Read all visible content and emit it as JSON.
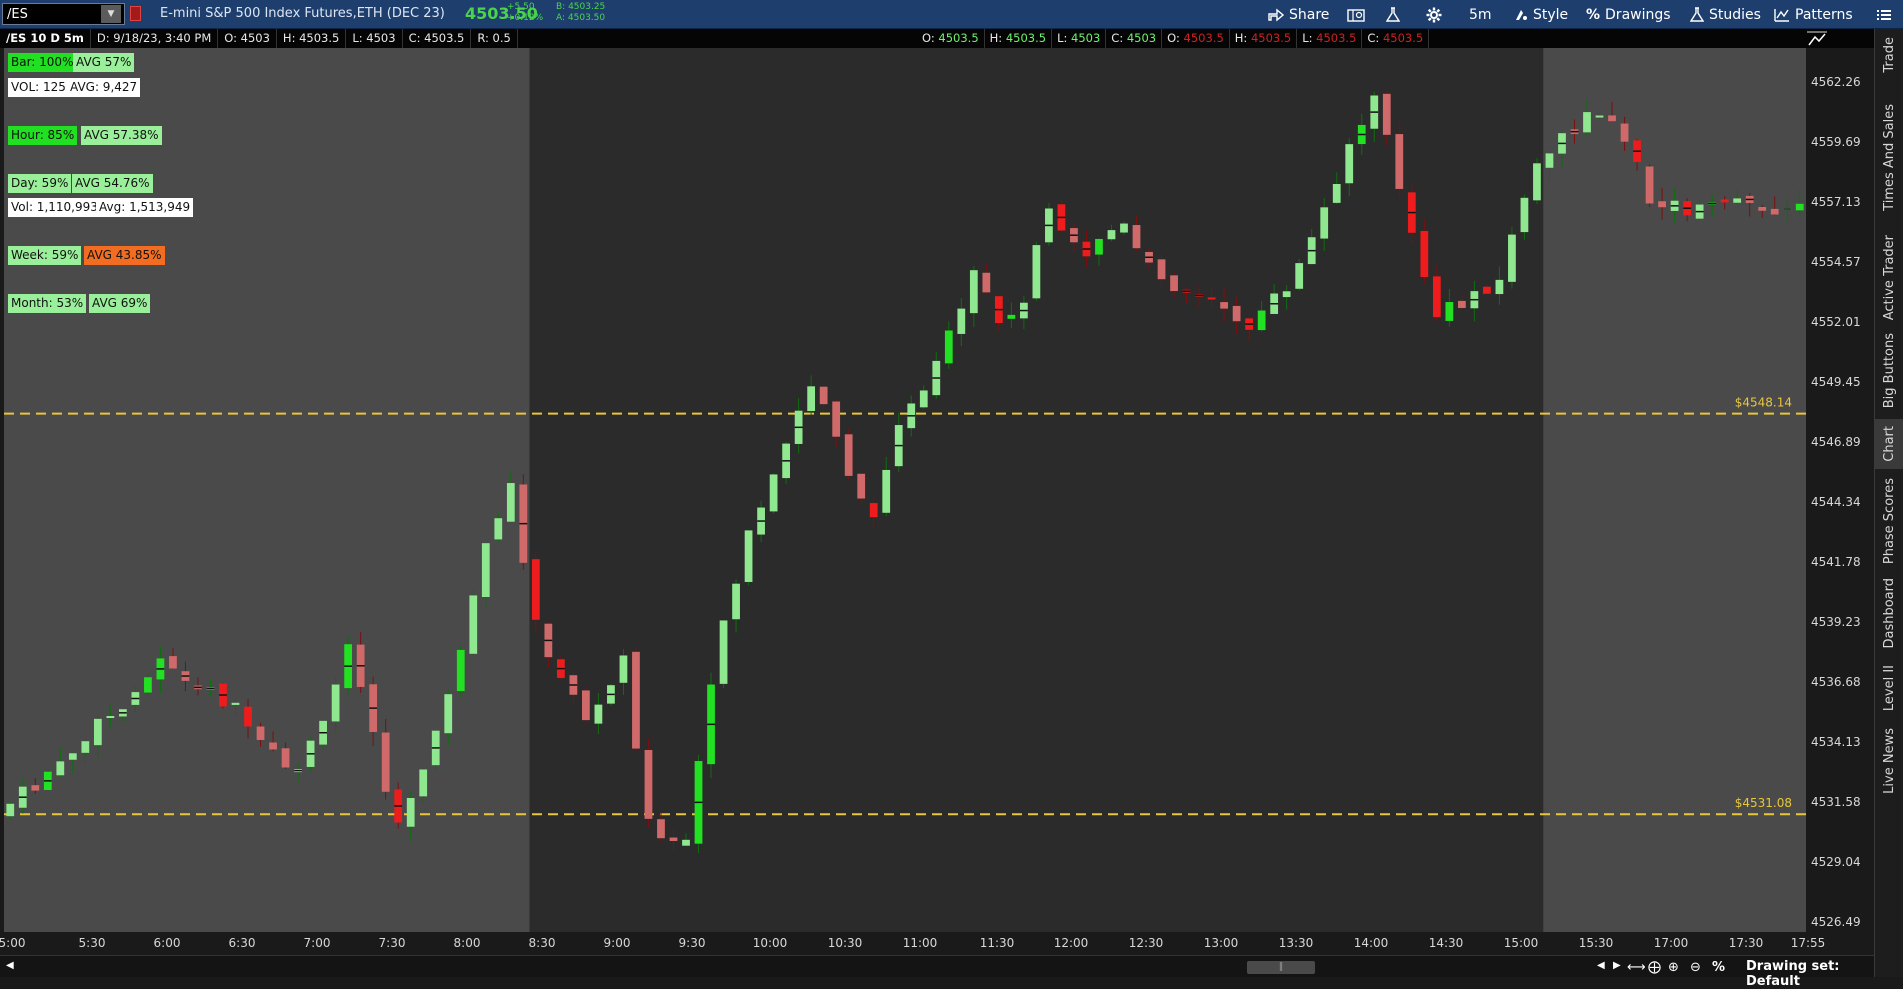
{
  "toolbar": {
    "symbol": "/ES",
    "description": "E-mini S&P 500 Index Futures,ETH (DEC 23)",
    "last_price": "4503.50",
    "change": "+5.50",
    "change_pct": "+0.12%",
    "bid": "B: 4503.25",
    "ask": "A: 4503.50",
    "share_label": "Share",
    "timeframe_label": "5m",
    "style_label": "Style",
    "drawings_label": "Drawings",
    "studies_label": "Studies",
    "patterns_label": "Patterns",
    "colors": {
      "bg": "#1e3f6e",
      "up": "#4ad44a"
    }
  },
  "infobar": {
    "chart_name": "/ES 10 D 5m",
    "date": "D: 9/18/23, 3:40 PM",
    "open": "O: 4503",
    "high": "H: 4503.5",
    "low": "L: 4503",
    "close": "C: 4503.5",
    "range": "R: 0.5",
    "overlay": [
      {
        "t": "O: ",
        "v": "4503.5",
        "c": "grn"
      },
      {
        "t": "H: ",
        "v": "4503.5",
        "c": "grn"
      },
      {
        "t": "L: ",
        "v": "4503",
        "c": "grn"
      },
      {
        "t": "C: ",
        "v": "4503",
        "c": "grn"
      },
      {
        "t": "O: ",
        "v": "4503.5",
        "c": "red"
      },
      {
        "t": "H: ",
        "v": "4503.5",
        "c": "red"
      },
      {
        "t": "L: ",
        "v": "4503.5",
        "c": "red"
      },
      {
        "t": "C: ",
        "v": "4503.5",
        "c": "red"
      }
    ]
  },
  "stats": {
    "bar": "Bar: 100%",
    "bar_avg": "AVG  57%",
    "vol": "VOL: 125",
    "vol_avg": "AVG: 9,427",
    "hour": "Hour: 85%",
    "hour_avg": "AVG  57.38%",
    "day": "Day: 59%",
    "day_avg": "AVG  54.76%",
    "day_vol": "Vol: 1,110,993",
    "day_vol_avg": "Avg: 1,513,949",
    "week": "Week: 59%",
    "week_avg": "AVG  43.85%",
    "month": "Month: 53%",
    "month_avg": "AVG  69%"
  },
  "side_tabs": [
    "Trade",
    "Times And Sales",
    "Active Trader",
    "Big Buttons",
    "Chart",
    "Phase Scores",
    "Dashboard",
    "Level II",
    "Live News"
  ],
  "bottom": {
    "drawing_set": "Drawing set: Default"
  },
  "chart_data": {
    "type": "candlestick",
    "price_axis_ticks": [
      "4562.26",
      "4559.69",
      "4557.13",
      "4554.57",
      "4552.01",
      "4549.45",
      "4546.89",
      "4544.34",
      "4541.78",
      "4539.23",
      "4536.68",
      "4534.13",
      "4531.58",
      "4529.04",
      "4526.49"
    ],
    "ylim": [
      4526.49,
      4562.26
    ],
    "time_axis_ticks": [
      "5:00",
      "5:30",
      "6:00",
      "6:30",
      "7:00",
      "7:30",
      "8:00",
      "8:30",
      "9:00",
      "9:30",
      "10:00",
      "10:30",
      "11:00",
      "11:30",
      "12:00",
      "12:30",
      "13:00",
      "13:30",
      "14:00",
      "14:30",
      "15:00",
      "15:30",
      "17:00",
      "17:30",
      "17:55"
    ],
    "levels": [
      {
        "label": "$4548.14",
        "value": 4548.14
      },
      {
        "label": "$4531.08",
        "value": 4531.08
      }
    ],
    "sessions": [
      {
        "name": "pre-market",
        "start_bar": 0,
        "end_bar": 42
      },
      {
        "name": "regular",
        "start_bar": 42,
        "end_bar": 123
      },
      {
        "name": "post-market",
        "start_bar": 123,
        "end_bar": 144
      }
    ],
    "anchors": [
      [
        0,
        4531.0
      ],
      [
        8,
        4534.8
      ],
      [
        13,
        4537.5
      ],
      [
        20,
        4535.2
      ],
      [
        24,
        4532.8
      ],
      [
        28,
        4538.0
      ],
      [
        32,
        4530.5
      ],
      [
        36,
        4536.0
      ],
      [
        39,
        4543.0
      ],
      [
        41,
        4545.0
      ],
      [
        43,
        4539.0
      ],
      [
        47,
        4535.0
      ],
      [
        50,
        4537.5
      ],
      [
        52,
        4530.5
      ],
      [
        55,
        4530.0
      ],
      [
        57,
        4537.0
      ],
      [
        60,
        4543.0
      ],
      [
        63,
        4547.0
      ],
      [
        65,
        4549.5
      ],
      [
        67,
        4547.0
      ],
      [
        70,
        4543.5
      ],
      [
        72,
        4547.5
      ],
      [
        75,
        4550.0
      ],
      [
        78,
        4554.5
      ],
      [
        80,
        4552.0
      ],
      [
        82,
        4553.0
      ],
      [
        84,
        4557.0
      ],
      [
        87,
        4555.0
      ],
      [
        90,
        4556.5
      ],
      [
        93,
        4553.5
      ],
      [
        96,
        4553.0
      ],
      [
        100,
        4552.0
      ],
      [
        103,
        4553.5
      ],
      [
        106,
        4557.0
      ],
      [
        108,
        4559.5
      ],
      [
        110,
        4561.5
      ],
      [
        113,
        4556.0
      ],
      [
        115,
        4552.5
      ],
      [
        118,
        4553.0
      ],
      [
        120,
        4554.0
      ],
      [
        123,
        4559.0
      ],
      [
        127,
        4560.8
      ],
      [
        130,
        4560.0
      ],
      [
        132,
        4557.0
      ],
      [
        135,
        4556.8
      ],
      [
        140,
        4557.0
      ],
      [
        144,
        4557.0
      ]
    ]
  }
}
